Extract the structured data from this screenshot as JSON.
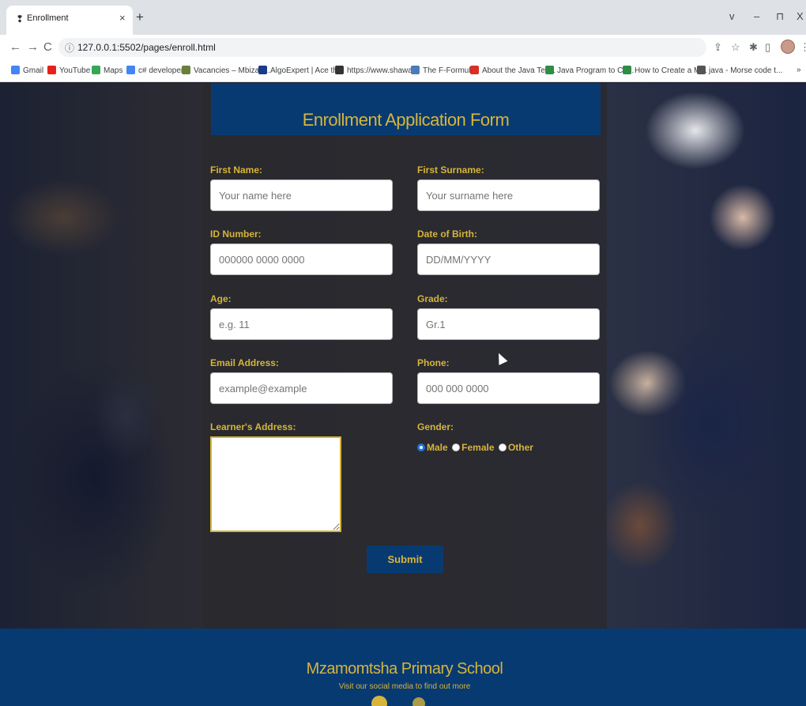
{
  "browser": {
    "tab_title": "Enrollment",
    "tab_close": "×",
    "new_tab": "+",
    "url": "127.0.0.1:5502/pages/enroll.html",
    "window_controls": [
      "v",
      "–",
      "⊓",
      "X"
    ]
  },
  "bookmarks": [
    {
      "label": "Gmail",
      "color": "#4285f4"
    },
    {
      "label": "YouTube",
      "color": "#e62117"
    },
    {
      "label": "Maps",
      "color": "#34a853"
    },
    {
      "label": "c# developer",
      "color": "#4285f4"
    },
    {
      "label": "Vacancies – Mbizan...",
      "color": "#6b7f3a"
    },
    {
      "label": "AlgoExpert | Ace th...",
      "color": "#1b3a8a"
    },
    {
      "label": "https://www.shawa...",
      "color": "#333333"
    },
    {
      "label": "The F-Formula",
      "color": "#4d7ab8"
    },
    {
      "label": "About the Java Tec...",
      "color": "#d93025"
    },
    {
      "label": "Java Program to Co...",
      "color": "#2f8d46"
    },
    {
      "label": "How to Create a M...",
      "color": "#2f8d46"
    },
    {
      "label": "java - Morse code t...",
      "color": "#555555"
    }
  ],
  "form": {
    "title": "Enrollment Application Form",
    "first_name": {
      "label": "First Name:",
      "placeholder": "Your name here"
    },
    "first_surname": {
      "label": "First Surname:",
      "placeholder": "Your surname here"
    },
    "id_number": {
      "label": "ID Number:",
      "placeholder": "000000 0000 0000"
    },
    "date_of_birth": {
      "label": "Date of Birth:",
      "placeholder": "DD/MM/YYYY"
    },
    "age": {
      "label": "Age:",
      "placeholder": "e.g. 11"
    },
    "grade": {
      "label": "Grade:",
      "placeholder": "Gr.1"
    },
    "email": {
      "label": "Email Address:",
      "placeholder": "example@example"
    },
    "phone": {
      "label": "Phone:",
      "placeholder": "000 000 0000"
    },
    "address": {
      "label": "Learner's Address:"
    },
    "gender": {
      "label": "Gender:",
      "options": [
        "Male",
        "Female",
        "Other"
      ],
      "selected": "Male"
    },
    "submit_label": "Submit"
  },
  "footer": {
    "school_name": "Mzamomtsha Primary School",
    "tagline": "Visit our social media to find out more"
  },
  "colors": {
    "accent_gold": "#d6b53a",
    "navy": "#083a72"
  }
}
